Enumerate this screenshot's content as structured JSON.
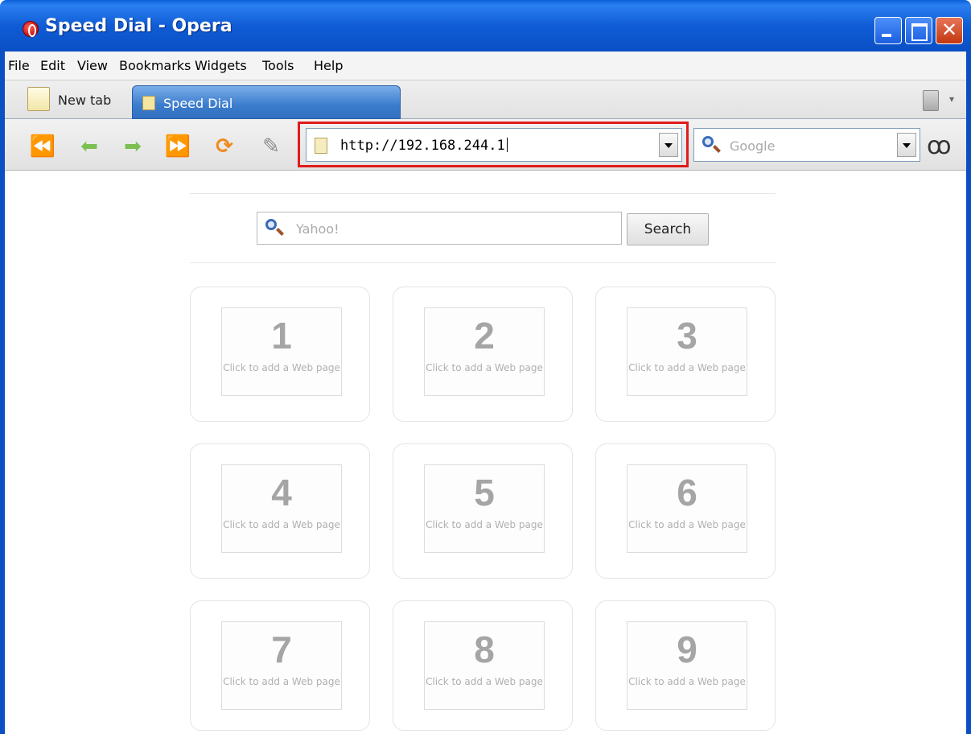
{
  "window": {
    "title": "Speed Dial - Opera"
  },
  "menu": {
    "items": [
      "File",
      "Edit",
      "View",
      "Bookmarks",
      "Widgets",
      "Tools",
      "Help"
    ]
  },
  "tabs": {
    "new_tab_label": "New tab",
    "active_label": "Speed Dial"
  },
  "toolbar": {
    "address_value": "http://192.168.244.1",
    "address_highlight_color": "#e01b1b",
    "search_placeholder": "Google"
  },
  "page": {
    "search_placeholder": "Yahoo!",
    "search_button": "Search",
    "dials": [
      {
        "number": "1",
        "text": "Click to add a Web page"
      },
      {
        "number": "2",
        "text": "Click to add a Web page"
      },
      {
        "number": "3",
        "text": "Click to add a Web page"
      },
      {
        "number": "4",
        "text": "Click to add a Web page"
      },
      {
        "number": "5",
        "text": "Click to add a Web page"
      },
      {
        "number": "6",
        "text": "Click to add a Web page"
      },
      {
        "number": "7",
        "text": "Click to add a Web page"
      },
      {
        "number": "8",
        "text": "Click to add a Web page"
      },
      {
        "number": "9",
        "text": "Click to add a Web page"
      }
    ]
  },
  "icons": [
    "opera-logo-icon",
    "new-tab-icon",
    "page-icon",
    "trash-icon",
    "rewind-icon",
    "back-icon",
    "forward-icon",
    "fast-forward-icon",
    "reload-icon",
    "edit-icon",
    "search-icon",
    "glasses-icon"
  ]
}
